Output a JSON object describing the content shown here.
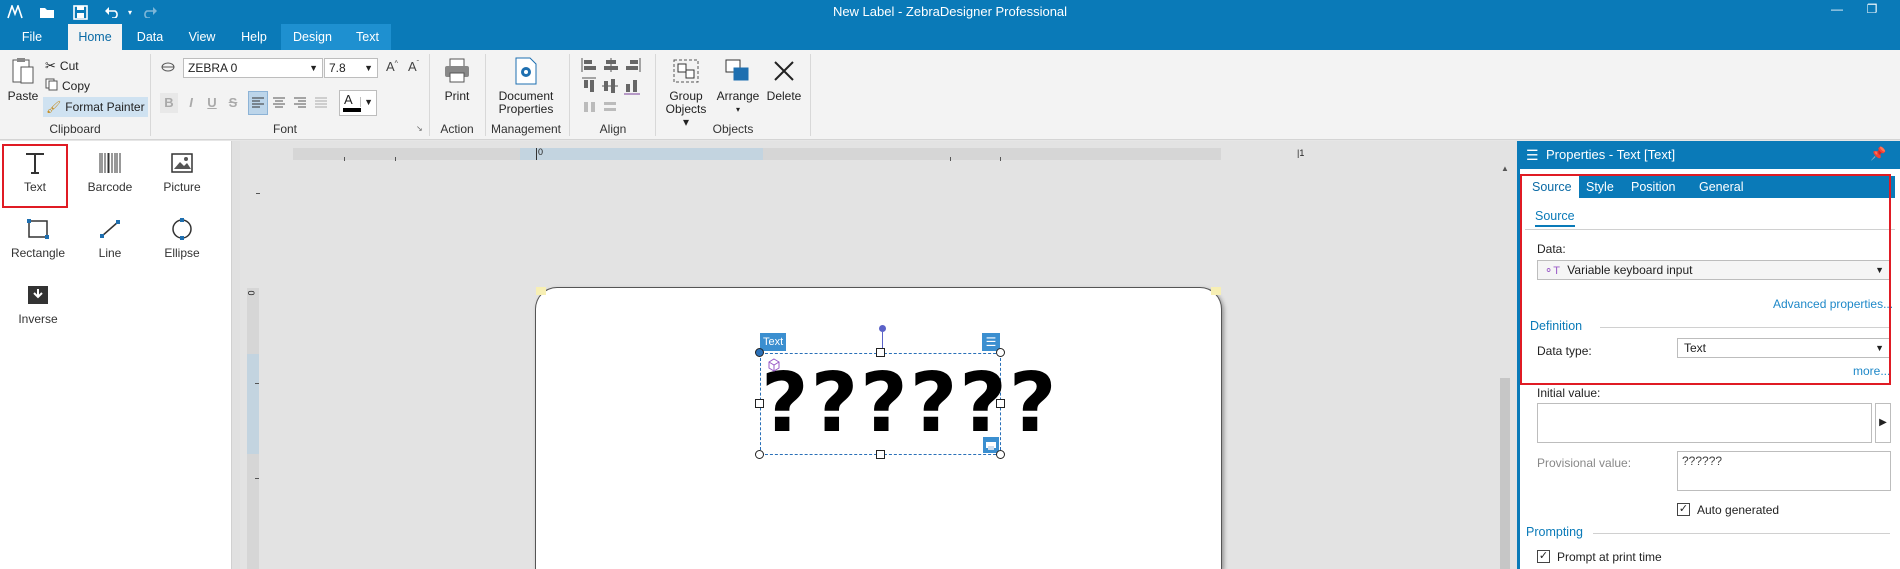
{
  "window": {
    "title": "New Label - ZebraDesigner Professional"
  },
  "menu_tabs": {
    "file": "File",
    "home": "Home",
    "data": "Data",
    "view": "View",
    "help": "Help",
    "design": "Design",
    "text": "Text"
  },
  "ribbon": {
    "clipboard": {
      "paste": "Paste",
      "cut": "Cut",
      "copy": "Copy",
      "format_painter": "Format Painter",
      "group_label": "Clipboard"
    },
    "font": {
      "family": "ZEBRA 0",
      "size": "7.8",
      "bold": "B",
      "italic": "I",
      "underline": "U",
      "strike": "S",
      "group_label": "Font",
      "color_letter": "A"
    },
    "action": {
      "print": "Print",
      "group_label": "Action"
    },
    "management": {
      "document_properties_line1": "Document",
      "document_properties_line2": "Properties",
      "group_label": "Management"
    },
    "align": {
      "group_label": "Align"
    },
    "objects": {
      "group_objects_line1": "Group",
      "group_objects_line2": "Objects",
      "arrange": "Arrange",
      "delete": "Delete",
      "group_label": "Objects"
    }
  },
  "toolbox": [
    {
      "label": "Text",
      "icon": "text-tool-icon"
    },
    {
      "label": "Barcode",
      "icon": "barcode-icon"
    },
    {
      "label": "Picture",
      "icon": "picture-icon"
    },
    {
      "label": "Rectangle",
      "icon": "rectangle-icon"
    },
    {
      "label": "Line",
      "icon": "line-icon"
    },
    {
      "label": "Ellipse",
      "icon": "ellipse-icon"
    },
    {
      "label": "Inverse",
      "icon": "inverse-icon"
    }
  ],
  "rulers": {
    "h_start": "0",
    "h_end": "1",
    "v_start": "0"
  },
  "canvas": {
    "object_tag": "Text",
    "object_content": "??????"
  },
  "properties": {
    "title": "Properties - Text [Text]",
    "tabs": [
      "Source",
      "Style",
      "Position",
      "General"
    ],
    "sub_tab": "Source",
    "data_label": "Data:",
    "data_value": "Variable keyboard input",
    "advanced_link": "Advanced properties...",
    "definition_section": "Definition",
    "data_type_label": "Data type:",
    "data_type_value": "Text",
    "more_link": "more...",
    "initial_value_label": "Initial value:",
    "initial_value": "",
    "provisional_value_label": "Provisional value:",
    "provisional_value": "??????",
    "auto_generated_label": "Auto generated",
    "auto_generated_checked": true,
    "prompting_section": "Prompting",
    "prompt_label": "Prompt at print time",
    "prompt_checked": true
  },
  "colors": {
    "accent": "#0a7ab8",
    "highlight": "#e01b24"
  }
}
